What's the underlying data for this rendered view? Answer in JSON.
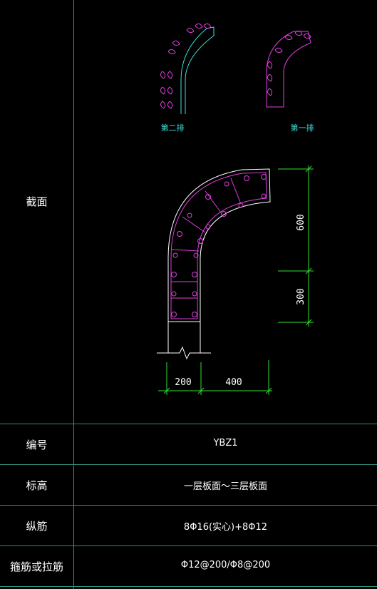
{
  "table": {
    "section_label": "截面",
    "rows": [
      {
        "label": "编号",
        "value": "YBZ1"
      },
      {
        "label": "标高",
        "value": "一层板面～三层板面"
      },
      {
        "label": "纵筋",
        "value": "8Φ16(实心)+8Φ12"
      },
      {
        "label": "箍筋或拉筋",
        "value": "Φ12@200/Φ8@200"
      }
    ]
  },
  "drawing": {
    "row2_label": "第二排",
    "row1_label": "第一排",
    "dims": {
      "v_top": "600",
      "v_bottom": "300",
      "h_left": "200",
      "h_right": "400"
    }
  },
  "colors": {
    "grid": "#2f8f7f",
    "concrete": "#ffffff",
    "rebar": "#e040e0",
    "row2": "#40e0e0",
    "dimension": "#30e030"
  }
}
